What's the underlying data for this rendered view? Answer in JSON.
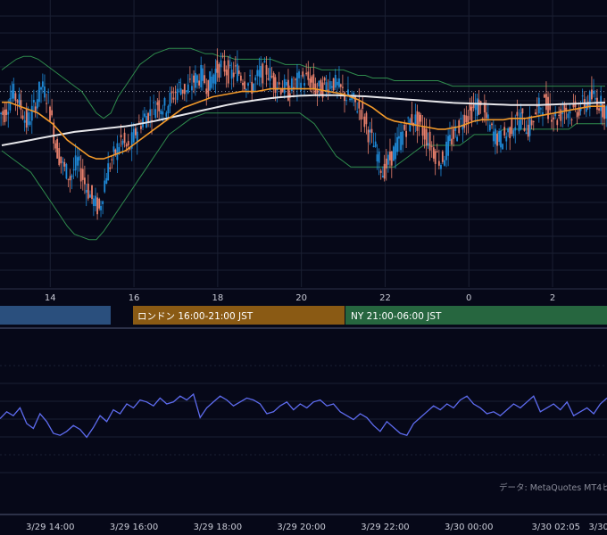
{
  "colors": {
    "background": "#060818",
    "grid": "#1b2033",
    "candle_up": "#1f8ad8",
    "candle_down": "#e8806c",
    "ma_fast": "#f39a2a",
    "ma_slow": "#e6e6ea",
    "bollinger": "#2f8c4d",
    "oscillator": "#5e6cf0",
    "session_tokyo": "#2a4f7d",
    "session_london": "#8a5a14",
    "session_ny": "#26663f",
    "separator": "#2c3148"
  },
  "sessions": [
    {
      "label": "",
      "color": "#2a4f7d"
    },
    {
      "label": "ロンドン 16:00-21:00 JST",
      "color": "#8a5a14"
    },
    {
      "label": "NY 21:00-06:00 JST",
      "color": "#26663f"
    }
  ],
  "watermark": "データ: MetaQuotes MT4ヒ",
  "chart_data": [
    {
      "type": "candlestick",
      "description_id": "price",
      "x_tick_labels": [
        "14",
        "16",
        "18",
        "20",
        "22",
        "0",
        "2"
      ],
      "x_hours": [
        14,
        16,
        18,
        20,
        22,
        24,
        26
      ],
      "x_range_hours": [
        12.8,
        27.3
      ],
      "y_range": [
        0,
        100
      ],
      "reference_line": 70,
      "series": [
        {
          "name": "close",
          "values": [
            62,
            70,
            66,
            58,
            64,
            72,
            67,
            50,
            42,
            38,
            44,
            36,
            30,
            26,
            40,
            46,
            52,
            48,
            55,
            60,
            62,
            66,
            64,
            68,
            72,
            70,
            74,
            76,
            72,
            78,
            80,
            76,
            78,
            74,
            72,
            76,
            78,
            74,
            72,
            70,
            73,
            75,
            74,
            70,
            72,
            74,
            71,
            68,
            66,
            63,
            55,
            48,
            40,
            45,
            50,
            56,
            60,
            58,
            53,
            48,
            44,
            50,
            55,
            60,
            62,
            65,
            61,
            55,
            52,
            54,
            58,
            60,
            56,
            62,
            66,
            63,
            60,
            64,
            62,
            64,
            66,
            68,
            65,
            62
          ]
        },
        {
          "name": "ma_fast",
          "values": [
            66,
            66,
            65,
            64,
            63,
            62,
            60,
            58,
            55,
            52,
            50,
            48,
            46,
            45,
            45,
            46,
            47,
            48,
            50,
            52,
            54,
            56,
            58,
            60,
            62,
            64,
            65,
            66,
            67,
            68,
            68.5,
            69,
            69.5,
            70,
            70,
            70,
            70.5,
            71,
            71,
            71,
            71,
            71,
            71,
            71,
            70.5,
            70,
            69.5,
            69,
            68,
            67,
            65.5,
            64,
            62,
            60,
            59,
            58.5,
            58,
            57.5,
            57,
            56.5,
            56,
            56,
            56.5,
            57,
            58,
            59,
            59.5,
            59.5,
            59.5,
            59.5,
            60,
            60,
            60,
            60.5,
            61,
            61.5,
            62,
            62.5,
            63,
            63.5,
            64,
            64.5,
            64.5,
            64.5
          ]
        },
        {
          "name": "ma_slow",
          "values": [
            50,
            50.5,
            51,
            51.5,
            52,
            52.5,
            53,
            53.5,
            54,
            54.5,
            55,
            55.3,
            55.6,
            55.9,
            56.2,
            56.5,
            56.8,
            57.1,
            57.5,
            58,
            58.5,
            59,
            59.6,
            60.2,
            60.8,
            61.4,
            62,
            62.6,
            63.2,
            63.8,
            64.4,
            65,
            65.5,
            66,
            66.4,
            66.8,
            67.2,
            67.5,
            67.8,
            68,
            68.2,
            68.4,
            68.5,
            68.6,
            68.6,
            68.6,
            68.6,
            68.5,
            68.4,
            68.3,
            68.2,
            68,
            67.8,
            67.6,
            67.4,
            67.2,
            67,
            66.8,
            66.6,
            66.4,
            66.2,
            66,
            65.8,
            65.7,
            65.6,
            65.5,
            65.4,
            65.3,
            65.2,
            65.1,
            65,
            65,
            65,
            65,
            65,
            65.1,
            65.2,
            65.3,
            65.4,
            65.5,
            65.6,
            65.7,
            65.8,
            65.9
          ]
        },
        {
          "name": "bollinger_upper",
          "values": [
            78,
            80,
            82,
            83,
            83,
            82,
            80,
            78,
            76,
            74,
            72,
            70,
            66,
            62,
            60,
            62,
            68,
            72,
            76,
            80,
            82,
            84,
            85,
            86,
            86,
            86,
            86,
            85,
            84,
            84,
            83,
            83,
            82,
            82,
            82,
            82,
            82,
            82,
            81,
            80,
            80,
            80,
            79,
            79,
            78,
            78,
            78,
            78,
            77,
            76,
            76,
            75,
            75,
            75,
            74,
            74,
            74,
            74,
            74,
            74,
            74,
            73,
            72,
            72,
            72,
            72,
            72,
            72,
            72,
            72,
            72,
            72,
            72,
            72,
            72,
            72,
            72,
            72,
            72,
            72,
            72,
            72,
            72,
            72
          ]
        },
        {
          "name": "bollinger_lower",
          "values": [
            48,
            46,
            44,
            42,
            40,
            36,
            32,
            28,
            24,
            20,
            17,
            16,
            15,
            15,
            18,
            22,
            26,
            30,
            34,
            38,
            42,
            46,
            50,
            54,
            56,
            58,
            60,
            61,
            62,
            62,
            62,
            62,
            62,
            62,
            62,
            62,
            62,
            62,
            62,
            62,
            62,
            62,
            60,
            58,
            54,
            50,
            46,
            44,
            42,
            42,
            42,
            42,
            42,
            42,
            42,
            44,
            46,
            48,
            50,
            50,
            50,
            50,
            50,
            50,
            52,
            54,
            54,
            54,
            54,
            56,
            56,
            56,
            56,
            56,
            56,
            56,
            56,
            56,
            56,
            58,
            58,
            58,
            58,
            58
          ]
        }
      ]
    },
    {
      "type": "line",
      "description_id": "oscillator",
      "y_range": [
        0,
        100
      ],
      "x_tick_labels": [
        "3/29 14:00",
        "3/29 16:00",
        "3/29 18:00",
        "3/29 20:00",
        "3/29 22:00",
        "3/30 00:00",
        "3/30 02:05",
        "3/30"
      ],
      "x_hours": [
        14,
        16,
        18,
        20,
        22,
        24,
        26.08,
        27.1
      ],
      "series": [
        {
          "name": "",
          "values": [
            55,
            62,
            58,
            66,
            50,
            45,
            60,
            52,
            40,
            38,
            42,
            48,
            44,
            36,
            46,
            58,
            52,
            64,
            60,
            70,
            66,
            74,
            72,
            68,
            76,
            70,
            72,
            78,
            74,
            80,
            56,
            66,
            72,
            78,
            74,
            68,
            72,
            76,
            74,
            70,
            60,
            62,
            68,
            72,
            64,
            70,
            66,
            72,
            74,
            68,
            70,
            62,
            58,
            54,
            60,
            56,
            48,
            42,
            52,
            46,
            40,
            38,
            50,
            56,
            62,
            68,
            64,
            70,
            66,
            74,
            78,
            70,
            66,
            60,
            62,
            58,
            64,
            70,
            66,
            72,
            78,
            62,
            66,
            70,
            64,
            72,
            58,
            62,
            66,
            60,
            70,
            76
          ]
        }
      ]
    }
  ]
}
